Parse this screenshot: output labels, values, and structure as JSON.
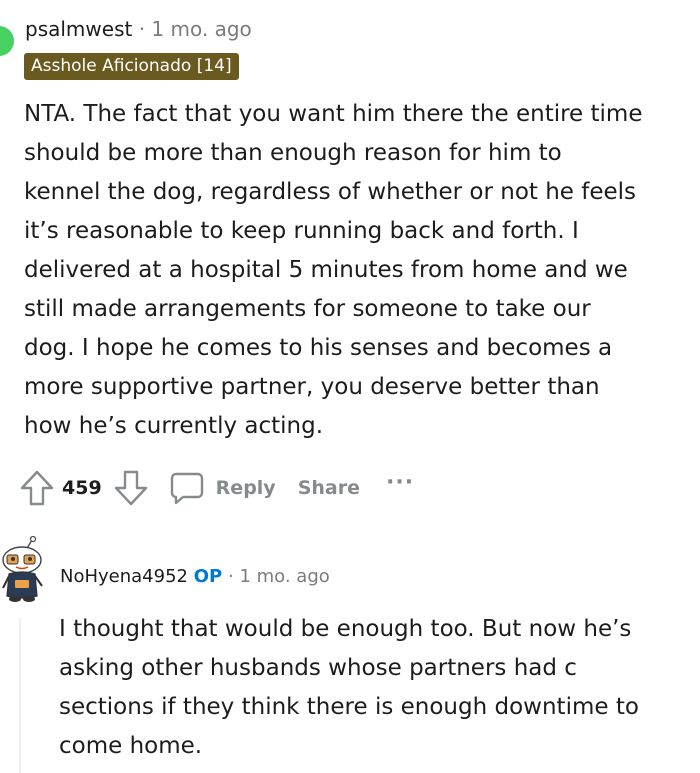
{
  "comment": {
    "username": "psalmwest",
    "separator": "·",
    "time": "1 mo. ago",
    "flair": "Asshole Aficionado [14]",
    "body_lines": [
      "NTA. The fact that you want him there the entire time",
      "should be more than enough reason for him to",
      "kennel the dog, regardless of whether or not he feels",
      "it’s reasonable to keep running back and forth. I",
      "delivered at a hospital 5 minutes from home and we",
      "still made arrangements for someone to take our",
      "dog. I hope he comes to his senses and becomes a",
      "more supportive partner, you deserve better than",
      "how he’s currently acting."
    ],
    "score": "459",
    "reply_label": "Reply",
    "share_label": "Share",
    "more_label": "···"
  },
  "reply": {
    "username": "NoHyena4952",
    "op_badge": "OP",
    "separator": "·",
    "time": "1 mo. ago",
    "body_lines": [
      "I thought that would be enough too. But now he’s",
      "asking other husbands whose partners had c",
      "sections if they think there is enough downtime to",
      "come home."
    ]
  },
  "colors": {
    "flair_bg": "#6b5a20",
    "op_blue": "#0079d3",
    "avatar_green": "#46d160",
    "action_gray": "#878a8c"
  },
  "icons": {
    "upvote": "upvote-icon",
    "downvote": "downvote-icon",
    "reply": "comment-bubble-icon",
    "avatar": "snoo-avatar-icon"
  }
}
